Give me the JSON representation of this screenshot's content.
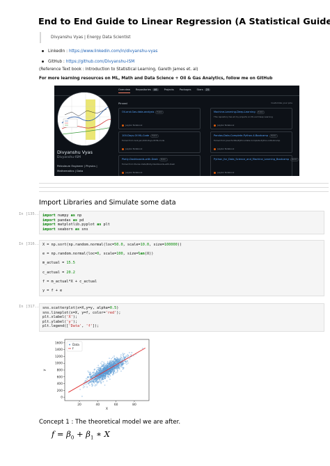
{
  "doc": {
    "title": "End to End Guide to Linear Regression (A Statistical Guide)",
    "author": "Divyanshu Vyas | Energy Data Scientist",
    "links": [
      {
        "label": "LinkedIn : ",
        "url": "https://www.linkedin.com/in/divyanshu-vyas"
      },
      {
        "label": "GitHub : ",
        "url": "https://github.com/Divyanshu-ISM"
      }
    ],
    "reference": "(Reference Text book : Introduction to Statistical Learning, Gareth James et. al)",
    "more": "For more learning resources on ML, Math and Data Science + Oil & Gas Analytics, follow me on GitHub"
  },
  "github": {
    "tabs": [
      {
        "label": "Overview",
        "count": ""
      },
      {
        "label": "Repositories",
        "count": "46"
      },
      {
        "label": "Projects",
        "count": ""
      },
      {
        "label": "Packages",
        "count": ""
      },
      {
        "label": "Stars",
        "count": "25"
      }
    ],
    "pinned": "Pinned",
    "customize": "Customize your pins",
    "name": "Divyanshu Vyas",
    "handle": "Divyanshu-ISM",
    "bio_line1": "Petroleum Engineer | Physics |",
    "bio_line2": "Mathematics | Data",
    "public": "Public",
    "repos": [
      {
        "name": "Oil-and-Gas-data-analysis",
        "desc": "",
        "lang": "Jupyter Notebook"
      },
      {
        "name": "Machine-Learning-Deep-Learning",
        "desc": "This repository has all my projects on ML and Deep Learning",
        "lang": "Jupyter Notebook"
      },
      {
        "name": "100-Days-Of-ML-Code",
        "desc": "Forked from Avik-Jain/100-Days-Of-ML-Code",
        "lang": "Jupyter Notebook"
      },
      {
        "name": "Pandas-Data-Complete-Python-4-Bootcamp",
        "desc": "Forked from Jose Portilla/Python-Data-Complete-Python-4-Bootcamp",
        "lang": "Jupyter Notebook"
      },
      {
        "name": "Plotly-Dashboards-with-Dash",
        "desc": "Forked from Pierian-Data/Plotly-Dashboards-with-Dash",
        "lang": "Jupyter Notebook"
      },
      {
        "name": "Python_for_Data_Science_and_Machine_Learning_Bootcamp",
        "desc": "",
        "lang": "Jupyter Notebook"
      }
    ]
  },
  "section": {
    "heading": "Import Libraries and Simulate some data",
    "concept": "Concept 1 : The theoretical model we are after."
  },
  "cells": [
    {
      "prompt": "In [135..",
      "lines": [
        "import numpy as np",
        "import pandas as pd",
        "import matplotlib.pyplot as plt",
        "import seaborn as sns"
      ]
    },
    {
      "prompt": "In [316..",
      "lines": [
        "X = np.sort(np.random.normal(loc=50.0, scale=10.0, size=100000))",
        "",
        "e = np.random.normal(loc=0, scale=100, size=len(X))",
        "",
        "m_actual = 15.5",
        "",
        "c_actual = 20.2",
        "",
        "f = m_actual*X + c_actual",
        "",
        "y = f + e"
      ]
    },
    {
      "prompt": "In [317..",
      "lines": [
        "sns.scatterplot(x=X,y=y, alpha=0.5)",
        "sns.lineplot(x=X, y=f, color='red');",
        "plt.xlabel('X');",
        "plt.ylabel('y');",
        "plt.legend(['Data', 'f']);"
      ]
    }
  ],
  "formula": {
    "lhs": "f",
    "eq": " = ",
    "b0": "β",
    "s0": "0",
    "plus": " + ",
    "b1": "β",
    "s1": "1",
    "times": " ∗ ",
    "x": "X"
  },
  "chart_data": {
    "type": "scatter",
    "title": "",
    "xlabel": "X",
    "ylabel": "y",
    "xlim": [
      4,
      96
    ],
    "ylim": [
      -100,
      1700
    ],
    "x_ticks": [
      20,
      40,
      60,
      80
    ],
    "y_ticks": [
      0,
      200,
      400,
      600,
      800,
      1000,
      1200,
      1400,
      1600
    ],
    "series": [
      {
        "name": "Data",
        "kind": "scatter",
        "color": "#5b9bd5",
        "model": {
          "slope": 15.5,
          "intercept": 20.2,
          "noise_sd": 100,
          "x_mean": 50,
          "x_sd": 10
        }
      },
      {
        "name": "f",
        "kind": "line",
        "color": "#e03030",
        "x": [
          8,
          92
        ],
        "y": [
          144.2,
          1446.2
        ]
      }
    ],
    "legend": "top-left",
    "grid": false
  }
}
